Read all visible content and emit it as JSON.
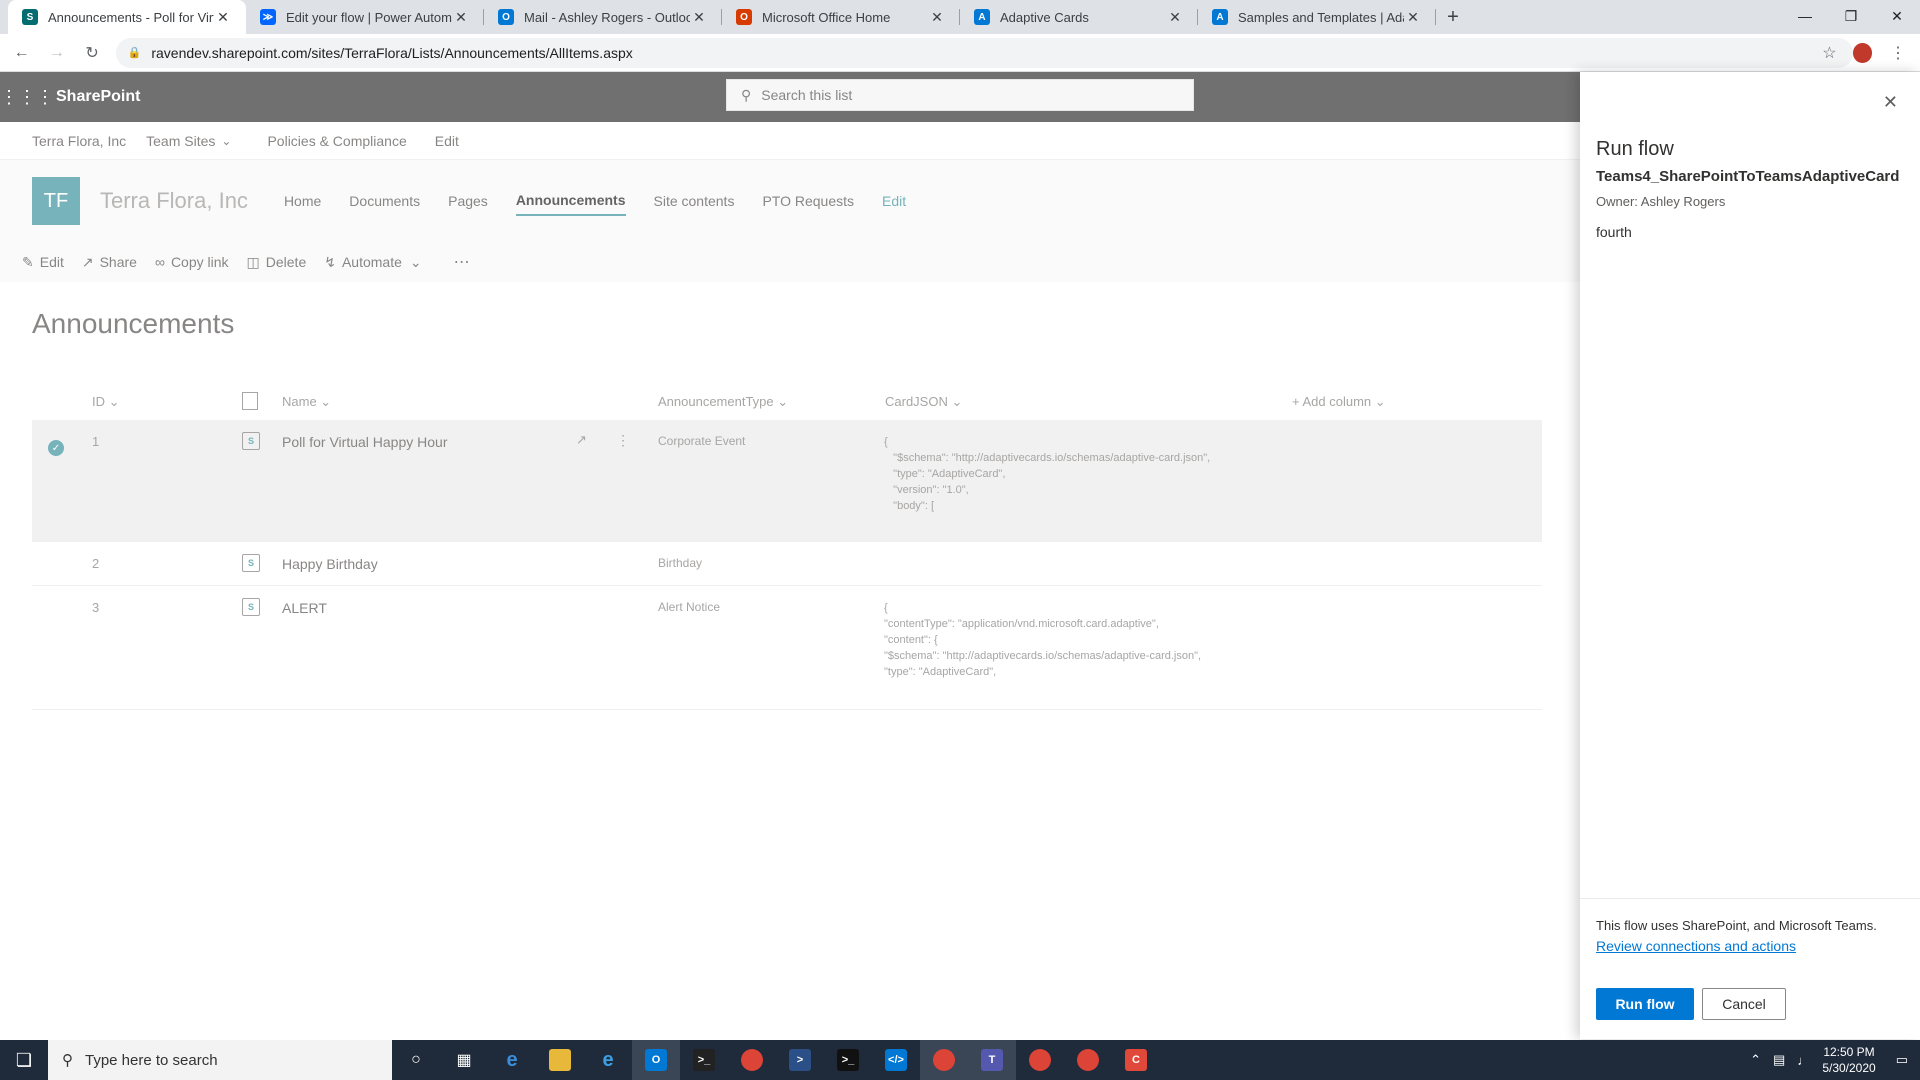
{
  "browser": {
    "tabs": [
      {
        "title": "Announcements - Poll for Virtual",
        "icon": "sharepoint-icon",
        "color": "#036c70",
        "glyph": "S",
        "active": true
      },
      {
        "title": "Edit your flow | Power Automate",
        "icon": "power-automate-icon",
        "color": "#0066ff",
        "glyph": "≫",
        "active": false
      },
      {
        "title": "Mail - Ashley Rogers - Outlook",
        "icon": "outlook-icon",
        "color": "#0078d4",
        "glyph": "O",
        "active": false
      },
      {
        "title": "Microsoft Office Home",
        "icon": "office-icon",
        "color": "#d83b01",
        "glyph": "O",
        "active": false
      },
      {
        "title": "Adaptive Cards",
        "icon": "adaptive-cards-icon",
        "color": "#0078d4",
        "glyph": "A",
        "active": false
      },
      {
        "title": "Samples and Templates | Adaptiv",
        "icon": "adaptive-cards-icon",
        "color": "#0078d4",
        "glyph": "A",
        "active": false
      }
    ],
    "url": "ravendev.sharepoint.com/sites/TerraFlora/Lists/Announcements/AllItems.aspx"
  },
  "suite": {
    "brand": "SharePoint",
    "search_placeholder": "Search this list"
  },
  "hub_nav": {
    "items": [
      "Terra Flora, Inc",
      "Team Sites",
      "Policies & Compliance",
      "Edit"
    ]
  },
  "site": {
    "logo": "TF",
    "title": "Terra Flora, Inc",
    "nav": [
      "Home",
      "Documents",
      "Pages",
      "Announcements",
      "Site contents",
      "PTO Requests",
      "Edit"
    ],
    "active_nav": "Announcements"
  },
  "commands": [
    "Edit",
    "Share",
    "Copy link",
    "Delete",
    "Automate"
  ],
  "list": {
    "title": "Announcements",
    "columns": {
      "id": "ID",
      "name": "Name",
      "type": "AnnouncementType",
      "json": "CardJSON",
      "add": "Add column"
    },
    "rows": [
      {
        "id": "1",
        "name": "Poll for Virtual Happy Hour",
        "type": "Corporate Event",
        "json": "{\n   \"$schema\": \"http://adaptivecards.io/schemas/adaptive-card.json\",\n   \"type\": \"AdaptiveCard\",\n   \"version\": \"1.0\",\n   \"body\": ["
      },
      {
        "id": "2",
        "name": "Happy Birthday",
        "type": "Birthday",
        "json": ""
      },
      {
        "id": "3",
        "name": "ALERT",
        "type": "Alert Notice",
        "json": "{\n\"contentType\": \"application/vnd.microsoft.card.adaptive\",\n\"content\": {\n\"$schema\": \"http://adaptivecards.io/schemas/adaptive-card.json\",\n\"type\": \"AdaptiveCard\","
      }
    ]
  },
  "panel": {
    "title": "Run flow",
    "flow_name": "Teams4_SharePointToTeamsAdaptiveCard",
    "owner": "Owner: Ashley Rogers",
    "item": "fourth",
    "uses_text": "This flow uses SharePoint, and Microsoft Teams.",
    "review_link": "Review connections and actions",
    "run_label": "Run flow",
    "cancel_label": "Cancel"
  },
  "taskbar": {
    "search_placeholder": "Type here to search",
    "time": "12:50 PM",
    "date": "5/30/2020"
  }
}
